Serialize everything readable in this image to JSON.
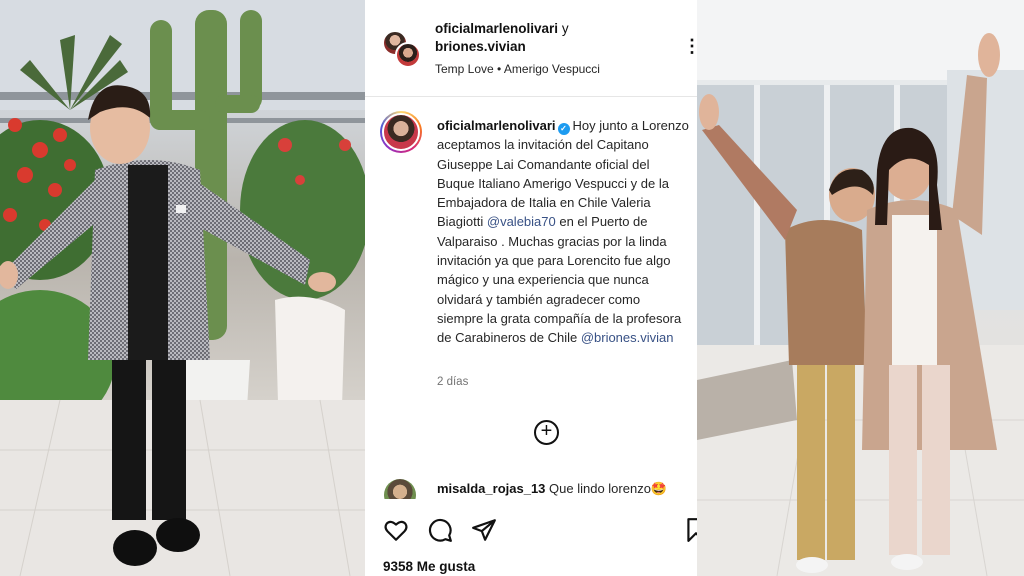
{
  "post": {
    "header": {
      "user1": "oficialmarlenolivari",
      "connector": "y",
      "user2": "briones.vivian",
      "music": "Temp Love • Amerigo Vespucci"
    },
    "caption": {
      "username": "oficialmarlenolivari",
      "text_part1": "Hoy junto a Lorenzo aceptamos la invitación del Capitano Giuseppe Lai Comandante oficial del Buque Italiano Amerigo Vespucci y de la Embajadora de Italia en Chile Valeria Biagiotti ",
      "mention1": "@valebia70",
      "text_part2": " en el Puerto de Valparaiso . Muchas gracias por la linda invitación ya que para Lorencito fue algo mágico y una experiencia que nunca olvidará y también agradecer como siempre la grata compañía de la profesora de Carabineros de Chile ",
      "mention2": "@briones.vivian",
      "time": "2 días"
    },
    "comment": {
      "username": "misalda_rojas_13",
      "text": "Que lindo lorenzo🤩"
    },
    "likes": "9358 Me gusta"
  }
}
